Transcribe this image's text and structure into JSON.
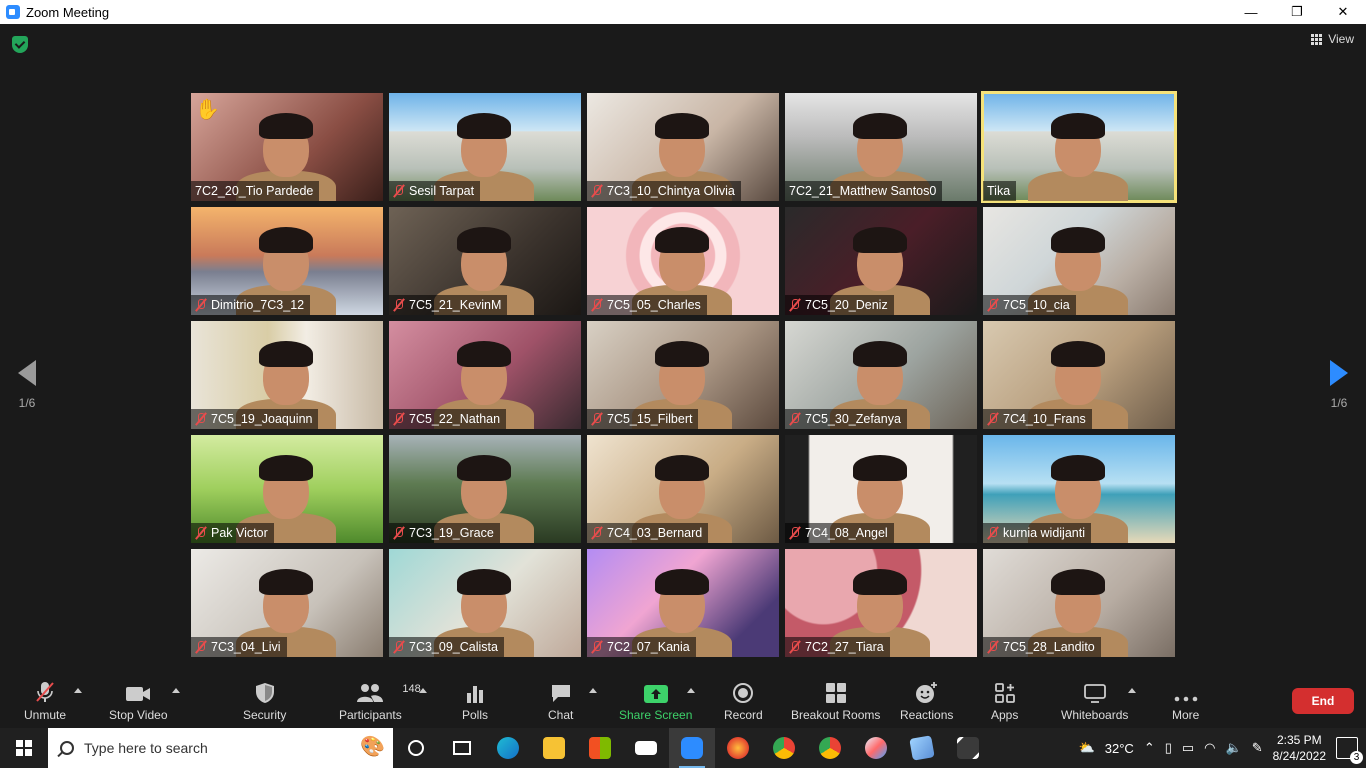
{
  "window": {
    "title": "Zoom Meeting",
    "controls": [
      "—",
      "❐",
      "✕"
    ]
  },
  "topbar": {
    "view_label": "View"
  },
  "pagination": {
    "left": "1/6",
    "right": "1/6"
  },
  "participants": [
    {
      "name": "7C2_20_Tio Pardede",
      "muted": false,
      "hand_raised": true,
      "bg": "bg-skin"
    },
    {
      "name": "Sesil Tarpat",
      "muted": true,
      "bg": "bg-school"
    },
    {
      "name": "7C3_10_Chintya Olivia",
      "muted": true,
      "bg": "bg-room"
    },
    {
      "name": "7C2_21_Matthew Santos0",
      "muted": false,
      "bg": "bg-building"
    },
    {
      "name": "Tika",
      "muted": false,
      "active_speaker": true,
      "bg": "bg-school"
    },
    {
      "name": "Dimitrio_7C3_12",
      "muted": true,
      "bg": "bg-bridge"
    },
    {
      "name": "7C5_21_KevinM",
      "muted": true,
      "bg": "bg-dark"
    },
    {
      "name": "7C5_05_Charles",
      "muted": true,
      "bg": "bg-heart"
    },
    {
      "name": "7C5_20_Deniz",
      "muted": true,
      "bg": "bg-stadium"
    },
    {
      "name": "7C5_10_cia",
      "muted": true,
      "bg": "bg-blur"
    },
    {
      "name": "7C5_19_Joaquinn",
      "muted": true,
      "bg": "bg-curtain"
    },
    {
      "name": "7C5_22_Nathan",
      "muted": true,
      "bg": "bg-pink"
    },
    {
      "name": "7C5_15_Filbert",
      "muted": true,
      "bg": "bg-shelf"
    },
    {
      "name": "7C5_30_Zefanya",
      "muted": true,
      "bg": "bg-lab"
    },
    {
      "name": "7C4_10_Frans",
      "muted": true,
      "bg": "bg-kitchen"
    },
    {
      "name": "Pak Victor",
      "muted": true,
      "bg": "bg-grass"
    },
    {
      "name": "7C3_19_Grace",
      "muted": true,
      "bg": "bg-field"
    },
    {
      "name": "7C4_03_Bernard",
      "muted": true,
      "bg": "bg-wall"
    },
    {
      "name": "7C4_08_Angel",
      "muted": true,
      "bg": "bg-white"
    },
    {
      "name": "kurnia widijanti",
      "muted": true,
      "bg": "bg-beach"
    },
    {
      "name": "7C3_04_Livi",
      "muted": true,
      "bg": "bg-plain"
    },
    {
      "name": "7C3_09_Calista",
      "muted": true,
      "bg": "bg-bed"
    },
    {
      "name": "7C2_07_Kania",
      "muted": true,
      "bg": "bg-neon"
    },
    {
      "name": "7C2_27_Tiara",
      "muted": true,
      "bg": "bg-umbrella"
    },
    {
      "name": "7C5_28_Landito",
      "muted": true,
      "bg": "bg-grey"
    }
  ],
  "toolbar": {
    "unmute": "Unmute",
    "stop_video": "Stop Video",
    "security": "Security",
    "participants": "Participants",
    "participants_count": "148",
    "polls": "Polls",
    "chat": "Chat",
    "share_screen": "Share Screen",
    "record": "Record",
    "breakout_rooms": "Breakout Rooms",
    "reactions": "Reactions",
    "apps": "Apps",
    "whiteboards": "Whiteboards",
    "more": "More",
    "end": "End"
  },
  "taskbar": {
    "search_placeholder": "Type here to search",
    "temperature": "32°C",
    "time": "2:35 PM",
    "date": "8/24/2022",
    "notifications": "3"
  },
  "colors": {
    "share_green": "#3dd26a",
    "end_red": "#d42f2f",
    "active_speaker": "#f5e27a",
    "accent_blue": "#2d8cff"
  }
}
